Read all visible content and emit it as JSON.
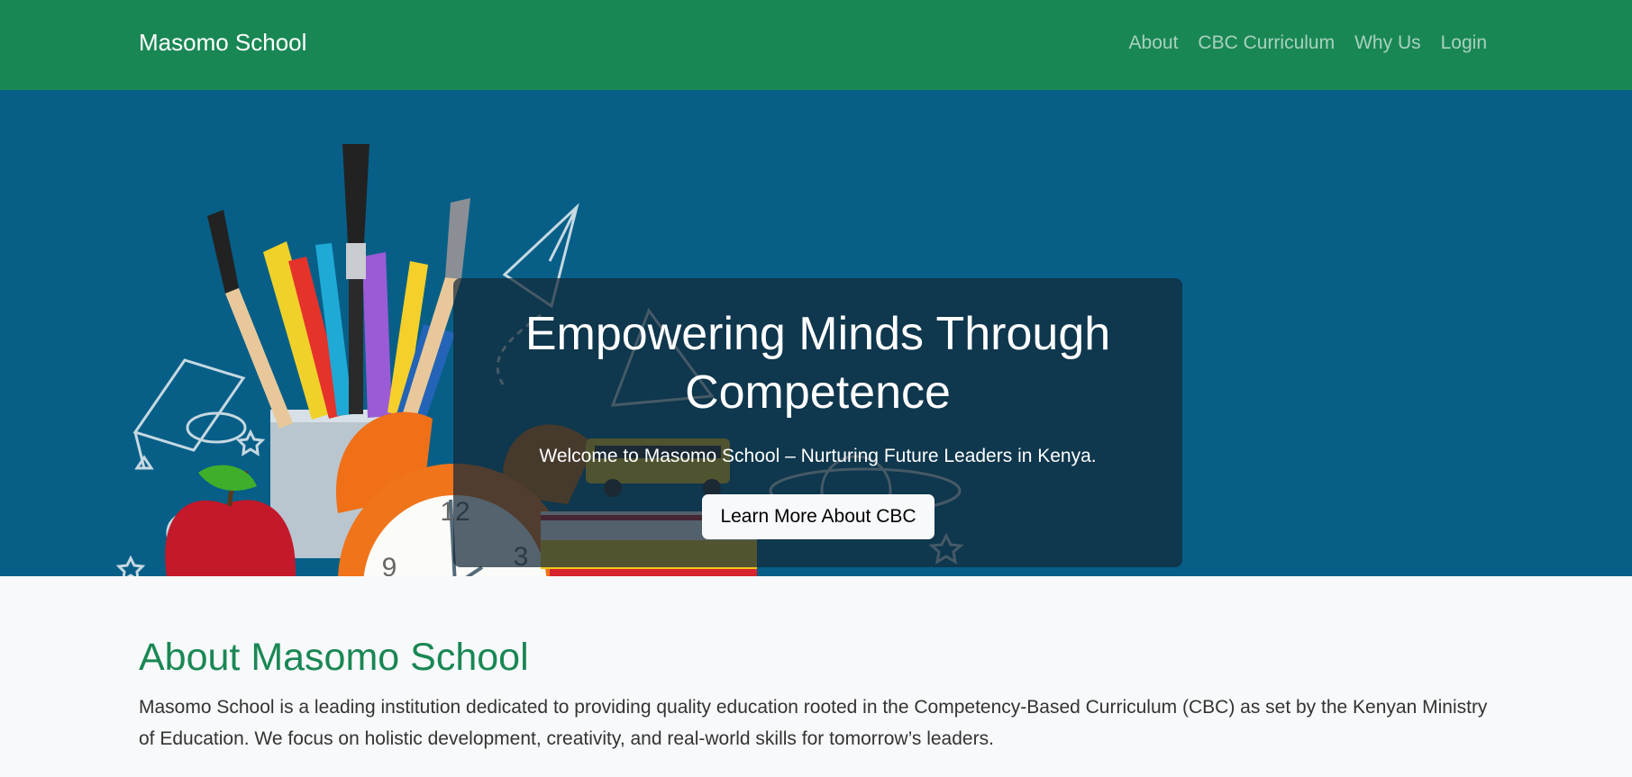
{
  "navbar": {
    "brand": "Masomo School",
    "links": [
      "About",
      "CBC Curriculum",
      "Why Us",
      "Login"
    ],
    "background_color": "#198754"
  },
  "hero": {
    "title": "Empowering Minds Through Competence",
    "subtitle": "Welcome to Masomo School – Nurturing Future Leaders in Kenya.",
    "button_label": "Learn More About CBC",
    "background_color": "#075f87",
    "illustration_icons": [
      "paint-brushes",
      "colored-pencils",
      "alarm-clock",
      "apple",
      "school-bus",
      "books",
      "graduation-cap",
      "planet",
      "paper-plane",
      "stars"
    ],
    "clock_numbers": [
      "12",
      "9",
      "3"
    ]
  },
  "about": {
    "heading": "About Masomo School",
    "text": "Masomo School is a leading institution dedicated to providing quality education rooted in the Competency-Based Curriculum (CBC) as set by the Kenyan Ministry of Education. We focus on holistic development, creativity, and real-world skills for tomorrow’s leaders.",
    "heading_color": "#198754"
  }
}
